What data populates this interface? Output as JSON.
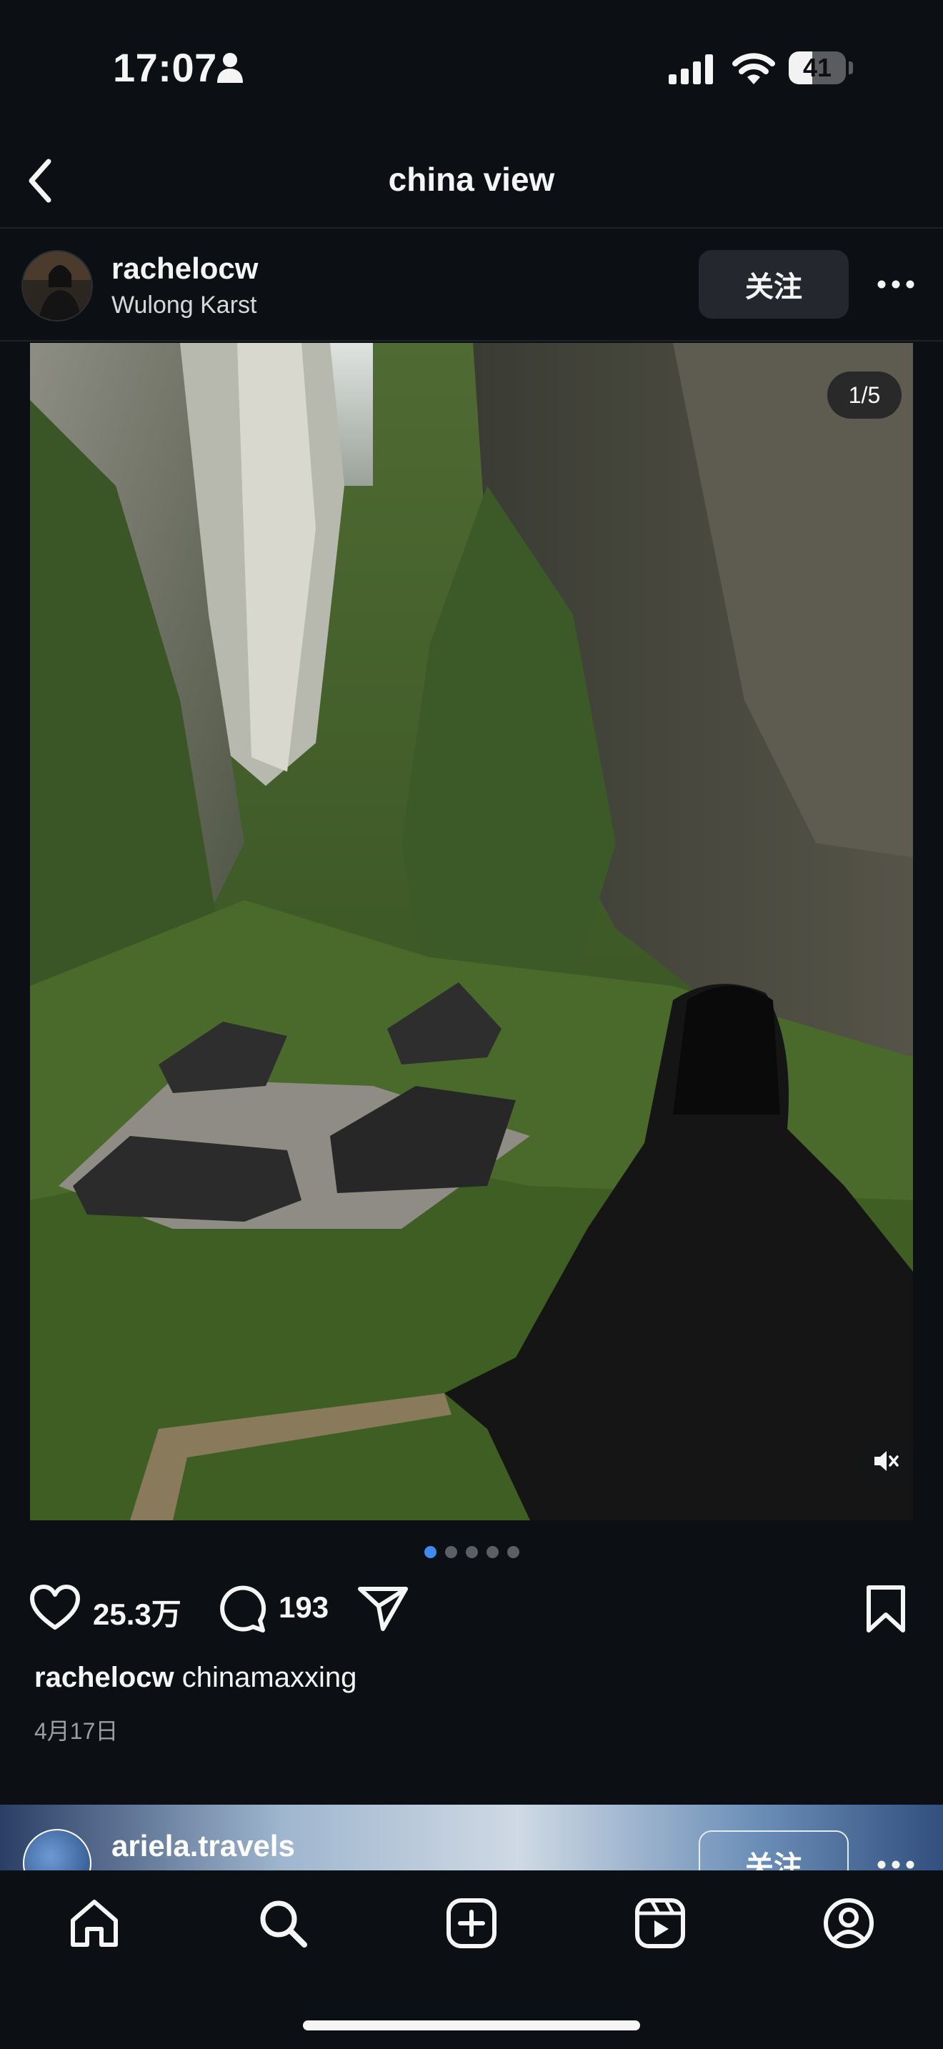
{
  "status_bar": {
    "time": "17:07",
    "battery": "41",
    "battery_level": 0.41
  },
  "header": {
    "title": "china view"
  },
  "post": {
    "username": "rachelocw",
    "location": "Wulong Karst",
    "follow_label": "关注",
    "photo_counter": "1/5",
    "photo_count": 5,
    "current_photo": 1,
    "likes": "25.3万",
    "comments": "193",
    "caption_username": "rachelocw",
    "caption_text": "chinamaxxing",
    "date": "4月17日"
  },
  "next_post": {
    "username": "ariela.travels",
    "follow_label": "关注"
  },
  "icons": {
    "status": [
      "person-icon",
      "signal-icon",
      "wifi-icon",
      "battery-icon"
    ],
    "nav": [
      "back-icon",
      "more-icon"
    ],
    "actions": [
      "heart-icon",
      "comment-icon",
      "share-icon",
      "bookmark-icon"
    ],
    "tabs": [
      "home-icon",
      "search-icon",
      "create-icon",
      "reels-icon",
      "profile-icon"
    ]
  },
  "colors": {
    "background": "#0c1014",
    "accent": "#3e8cf0",
    "button": "#24282e"
  }
}
